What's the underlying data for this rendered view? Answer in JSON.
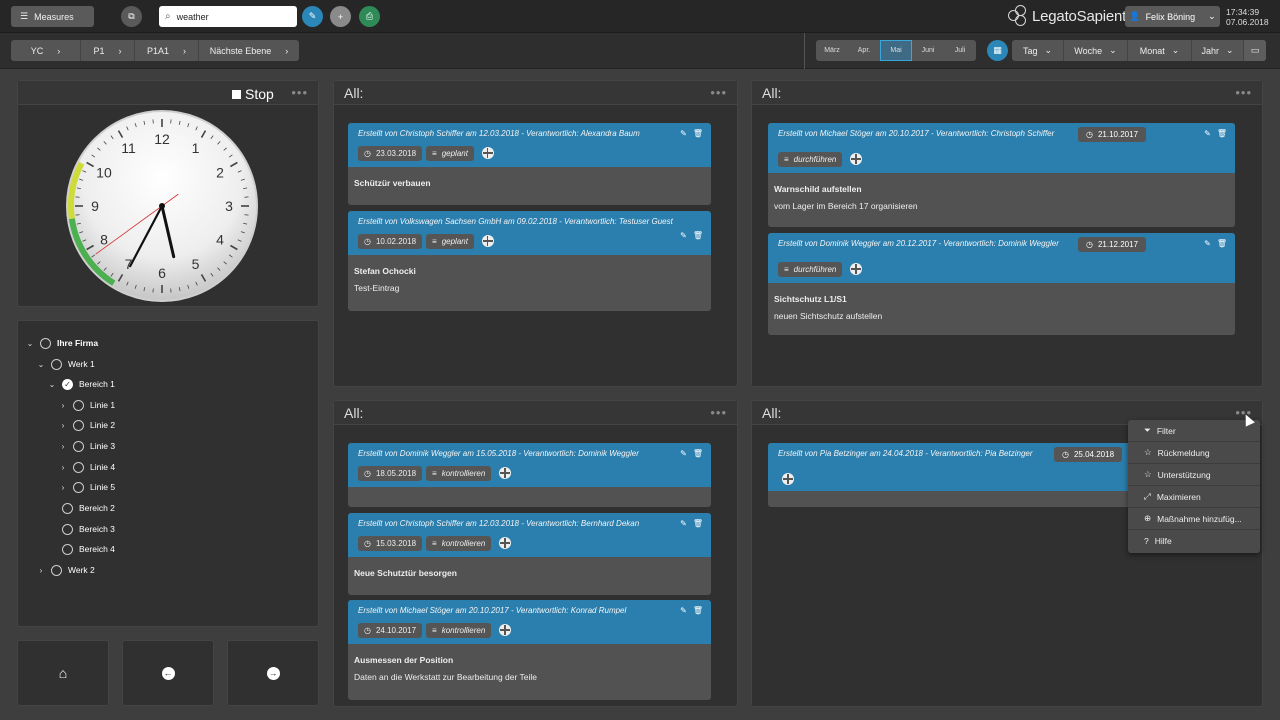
{
  "topbar": {
    "measures_label": "Measures",
    "search_value": "weather",
    "logo_text": "LegatoSapient",
    "user_name": "Felix Böning",
    "time": "17:34:39",
    "date": "07.06.2018"
  },
  "breadcrumb": [
    "YC",
    "P1",
    "P1A1",
    "Nächste Ebene"
  ],
  "months": [
    "März",
    "Apr.",
    "Mai",
    "Juni",
    "Juli"
  ],
  "active_month": "Mai",
  "periods": [
    "Tag",
    "Woche",
    "Monat",
    "Jahr"
  ],
  "clock": {
    "stop_label": "Stop",
    "numbers": [
      "12",
      "1",
      "2",
      "3",
      "4",
      "5",
      "6",
      "7",
      "8",
      "9",
      "10",
      "11"
    ],
    "hour": 5,
    "minute": 34,
    "second": 39
  },
  "tree": [
    {
      "label": "Ihre Firma",
      "bold": true
    },
    {
      "label": "Werk 1"
    },
    {
      "label": "Bereich 1"
    },
    {
      "label": "Linie 1"
    },
    {
      "label": "Linie 2"
    },
    {
      "label": "Linie 3"
    },
    {
      "label": "Linie 4"
    },
    {
      "label": "Linie 5"
    },
    {
      "label": "Bereich 2"
    },
    {
      "label": "Bereich 3"
    },
    {
      "label": "Bereich 4"
    },
    {
      "label": "Werk 2"
    }
  ],
  "panels": {
    "p1_title": "All:",
    "p2_title": "All:",
    "p3_title": "All:",
    "p4_title": "All:"
  },
  "cards": {
    "c1": {
      "meta": "Erstellt von Christoph Schiffer am 12.03.2018 - Verantwortlich: Alexandra Baum",
      "date": "23.03.2018",
      "status": "geplant",
      "title": "Schützür verbauen",
      "desc": ""
    },
    "c2": {
      "meta": "Erstellt von Volkswagen Sachsen GmbH am 09.02.2018 - Verantwortlich: Testuser Guest",
      "date": "10.02.2018",
      "status": "geplant",
      "title": "Stefan Ochocki",
      "desc": "Test-Eintrag"
    },
    "c3": {
      "meta": "Erstellt von Michael Stöger am 20.10.2017 - Verantwortlich: Christoph Schiffer",
      "date": "21.10.2017",
      "status": "durchführen",
      "title": "Warnschild aufstellen",
      "desc": "vom Lager im Bereich 17 organisieren"
    },
    "c4": {
      "meta": "Erstellt von Dominik Weggler am 20.12.2017 - Verantwortlich: Dominik Weggler",
      "date": "21.12.2017",
      "status": "durchführen",
      "title": "Sichtschutz L1/S1",
      "desc": "neuen Sichtschutz aufstellen"
    },
    "c5": {
      "meta": "Erstellt von Dominik Weggler am 15.05.2018 - Verantwortlich: Dominik Weggler",
      "date": "18.05.2018",
      "status": "kontrollieren",
      "title": "",
      "desc": ""
    },
    "c6": {
      "meta": "Erstellt von Christoph Schiffer am 12.03.2018 - Verantwortlich: Bernhard Dekan",
      "date": "15.03.2018",
      "status": "kontrollieren",
      "title": "Neue Schutztür besorgen",
      "desc": ""
    },
    "c7": {
      "meta": "Erstellt von Michael Stöger am 20.10.2017 - Verantwortlich: Konrad Rumpel",
      "date": "24.10.2017",
      "status": "kontrollieren",
      "title": "Ausmessen der Position",
      "desc": "Daten an die Werkstatt zur Bearbeitung der Teile"
    },
    "c8": {
      "meta": "Erstellt von Pia Betzinger am 24.04.2018 - Verantwortlich: Pia Betzinger",
      "date": "25.04.2018"
    }
  },
  "menu": [
    "Filter",
    "Rückmeldung",
    "Unterstützung",
    "Maximieren",
    "Maßnahme hinzufüg...",
    "Hilfe"
  ],
  "colors": {
    "accent": "#2b7fae",
    "save_green": "#2e8b57"
  }
}
